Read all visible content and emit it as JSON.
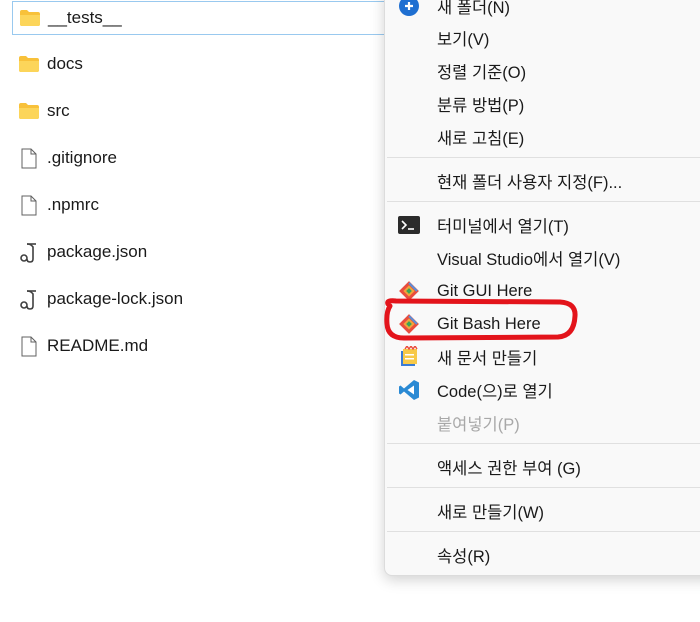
{
  "file_list": {
    "items": [
      {
        "name": "__tests__",
        "type": "folder",
        "selected": true
      },
      {
        "name": "docs",
        "type": "folder"
      },
      {
        "name": "src",
        "type": "folder"
      },
      {
        "name": ".gitignore",
        "type": "file"
      },
      {
        "name": ".npmrc",
        "type": "file"
      },
      {
        "name": "package.json",
        "type": "json"
      },
      {
        "name": "package-lock.json",
        "type": "json"
      },
      {
        "name": "README.md",
        "type": "file"
      }
    ]
  },
  "context_menu": {
    "items": [
      {
        "label": "새 폴더(N)",
        "icon": "new-folder-icon"
      },
      {
        "label": "보기(V)"
      },
      {
        "label": "정렬 기준(O)"
      },
      {
        "label": "분류 방법(P)"
      },
      {
        "label": "새로 고침(E)"
      },
      {
        "label": "현재 폴더 사용자 지정(F)..."
      },
      {
        "label": "터미널에서 열기(T)",
        "icon": "terminal-icon"
      },
      {
        "label": "Visual Studio에서 열기(V)"
      },
      {
        "label": "Git GUI Here",
        "icon": "git-icon"
      },
      {
        "label": "Git Bash Here",
        "icon": "git-icon",
        "annotated": true
      },
      {
        "label": "새 문서 만들기",
        "icon": "new-document-icon"
      },
      {
        "label": "Code(으)로 열기",
        "icon": "vscode-icon"
      },
      {
        "label": "붙여넣기(P)",
        "disabled": true
      },
      {
        "label": "액세스 권한 부여 (G)"
      },
      {
        "label": "새로 만들기(W)"
      },
      {
        "label": "속성(R)"
      }
    ]
  },
  "colors": {
    "folder": "#f8c13a",
    "selection_border": "#99c9ef",
    "menu_bg": "#f9f9f9",
    "annotation_red": "#e3141b",
    "vscode_blue": "#2a8ad4"
  }
}
